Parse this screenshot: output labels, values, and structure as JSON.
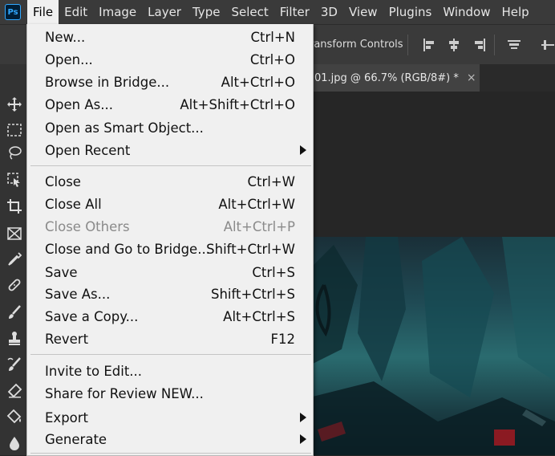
{
  "app": {
    "logo": "Ps"
  },
  "menubar": [
    "File",
    "Edit",
    "Image",
    "Layer",
    "Type",
    "Select",
    "Filter",
    "3D",
    "View",
    "Plugins",
    "Window",
    "Help"
  ],
  "options": {
    "transform_label": "ransform Controls"
  },
  "document_tab": {
    "title": "01.jpg @ 66.7% (RGB/8#) *",
    "close": "×"
  },
  "file_menu": {
    "items": [
      {
        "label": "New...",
        "shortcut": "Ctrl+N"
      },
      {
        "label": "Open...",
        "shortcut": "Ctrl+O"
      },
      {
        "label": "Browse in Bridge...",
        "shortcut": "Alt+Ctrl+O"
      },
      {
        "label": "Open As...",
        "shortcut": "Alt+Shift+Ctrl+O"
      },
      {
        "label": "Open as Smart Object...",
        "shortcut": ""
      },
      {
        "label": "Open Recent",
        "shortcut": ""
      },
      {
        "label": "Close",
        "shortcut": "Ctrl+W"
      },
      {
        "label": "Close All",
        "shortcut": "Alt+Ctrl+W"
      },
      {
        "label": "Close Others",
        "shortcut": "Alt+Ctrl+P"
      },
      {
        "label": "Close and Go to Bridge...",
        "shortcut": "Shift+Ctrl+W"
      },
      {
        "label": "Save",
        "shortcut": "Ctrl+S"
      },
      {
        "label": "Save As...",
        "shortcut": "Shift+Ctrl+S"
      },
      {
        "label": "Save a Copy...",
        "shortcut": "Alt+Ctrl+S"
      },
      {
        "label": "Revert",
        "shortcut": "F12"
      },
      {
        "label": "Invite to Edit...",
        "shortcut": ""
      },
      {
        "label": "Share for Review NEW...",
        "shortcut": ""
      },
      {
        "label": "Export",
        "shortcut": ""
      },
      {
        "label": "Generate",
        "shortcut": ""
      }
    ]
  },
  "toolbar": {
    "tools": [
      "move-tool-icon",
      "marquee-tool-icon",
      "lasso-tool-icon",
      "object-select-tool-icon",
      "crop-tool-icon",
      "frame-tool-icon",
      "eyedropper-tool-icon",
      "healing-brush-tool-icon",
      "brush-tool-icon",
      "clone-stamp-tool-icon",
      "history-brush-tool-icon",
      "eraser-tool-icon",
      "paint-bucket-tool-icon",
      "blur-tool-icon"
    ]
  }
}
